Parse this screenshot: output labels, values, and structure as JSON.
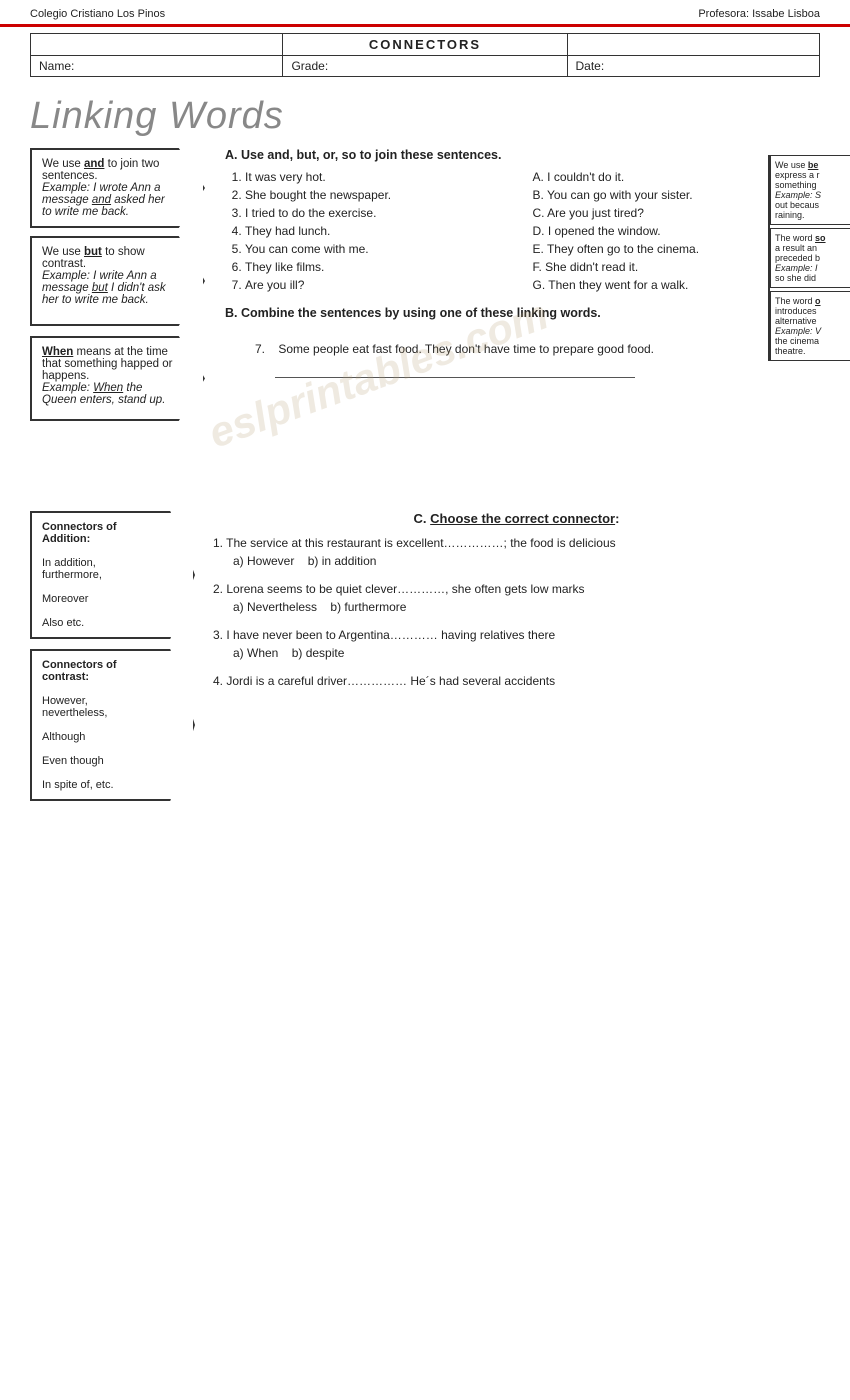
{
  "header": {
    "school": "Colegio Cristiano Los Pinos",
    "teacher": "Profesora: Issabe Lisboa"
  },
  "info_table": {
    "title": "CONNECTORS",
    "name_label": "Name:",
    "grade_label": "Grade:",
    "date_label": "Date:"
  },
  "linking_words_title": "Linking Words",
  "box1": {
    "line1": "We use",
    "keyword": "and",
    "line2": "to join two sentences.",
    "example_label": "Example:",
    "example": "I wrote Ann a message",
    "and_text": "and",
    "example2": "asked her to write me back."
  },
  "box2": {
    "line1": "We use",
    "keyword": "but",
    "line2": "to show contrast.",
    "example_label": "Example:",
    "example": "I write Ann a message",
    "but_text": "but",
    "example2": "I didn't ask her to write me back."
  },
  "section_a": {
    "title": "A. Use and, but, or, so to join these sentences.",
    "sentences": [
      "It was very hot.",
      "She bought the newspaper.",
      "I tried to do the exercise.",
      "They had lunch.",
      "You can come with me.",
      "They like films.",
      "Are you ill?"
    ],
    "matches": [
      "A.  I couldn't do it.",
      "B.  You can go with your sister.",
      "C.  Are you just tired?",
      "D.  I opened the window.",
      "E.  They often go to the cinema.",
      "F.  She didn't read it.",
      "G.  Then they went for a walk."
    ]
  },
  "section_b": {
    "title": "B. Combine the sentences by using one of these linking words.",
    "item7": "Some people eat fast food. They don't have time to prepare good food."
  },
  "box_when": {
    "keyword": "When",
    "line1": "means at the time that something happed or happens.",
    "example_label": "Example:",
    "example_keyword": "When",
    "example": "the Queen enters, stand up."
  },
  "right_boxes": [
    {
      "keyword": "because",
      "text1": "We use",
      "text2": "to express a reason for something.",
      "example_label": "Example: S",
      "example": "out because it was raining."
    },
    {
      "keyword": "so",
      "text1": "The word",
      "text2": "gives a result and is preceded by a comma.",
      "example_label": "Example: I",
      "example": "so she did..."
    },
    {
      "keyword": "or",
      "text1": "The word",
      "text2": "introduces an alternative.",
      "example_label": "Example: W",
      "example": "the cinema or the theatre."
    }
  ],
  "watermark": "eslprintables.com",
  "section_c": {
    "title": "C. Choose the correct connector",
    "questions": [
      {
        "num": "1.",
        "text": "The service at this restaurant is excellent……………; the food is delicious",
        "options": [
          "a)  However",
          "b) in addition"
        ]
      },
      {
        "num": "2.",
        "text": "Lorena seems to be quiet clever…………, she often gets low marks",
        "options": [
          "a)  Nevertheless",
          "b) furthermore"
        ]
      },
      {
        "num": "3.",
        "text": "I have never been to Argentina………… having relatives there",
        "options": [
          "a)  When",
          "b) despite"
        ]
      },
      {
        "num": "4.",
        "text": "Jordi is a careful driver…………… He´s had several accidents",
        "options": []
      }
    ]
  },
  "connector_box_addition": {
    "title": "Connectors of Addition:",
    "items": [
      "In addition,",
      "furthermore,",
      "",
      "Moreover",
      "",
      "Also etc."
    ]
  },
  "connector_box_contrast": {
    "title": "Connectors of contrast:",
    "items": [
      "However,",
      "nevertheless,",
      "",
      "Although",
      "",
      "Even though",
      "",
      "In spite of, etc."
    ]
  }
}
